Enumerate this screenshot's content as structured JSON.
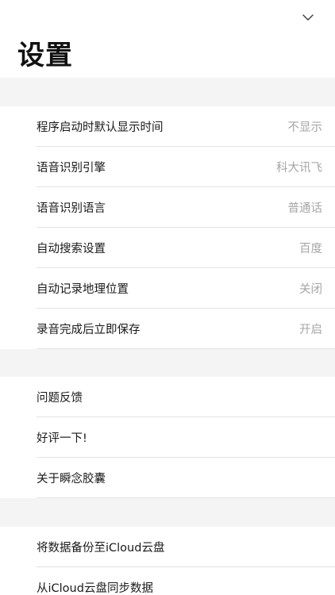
{
  "header": {
    "title": "设置",
    "collapse_icon": "chevron-down-icon"
  },
  "groups": [
    {
      "items": [
        {
          "label": "程序启动时默认显示时间",
          "value": "不显示"
        },
        {
          "label": "语音识别引擎",
          "value": "科大讯飞"
        },
        {
          "label": "语音识别语言",
          "value": "普通话"
        },
        {
          "label": "自动搜索设置",
          "value": "百度"
        },
        {
          "label": "自动记录地理位置",
          "value": "关闭"
        },
        {
          "label": "录音完成后立即保存",
          "value": "开启"
        }
      ]
    },
    {
      "items": [
        {
          "label": "问题反馈"
        },
        {
          "label": "好评一下!"
        },
        {
          "label": "关于瞬念胶囊"
        }
      ]
    },
    {
      "items": [
        {
          "label": "将数据备份至iCloud云盘"
        },
        {
          "label": "从iCloud云盘同步数据"
        }
      ]
    }
  ],
  "colors": {
    "separator_band": "#f4f4f4",
    "value_text": "#a6a6a6",
    "divider": "#e3e3e3"
  }
}
